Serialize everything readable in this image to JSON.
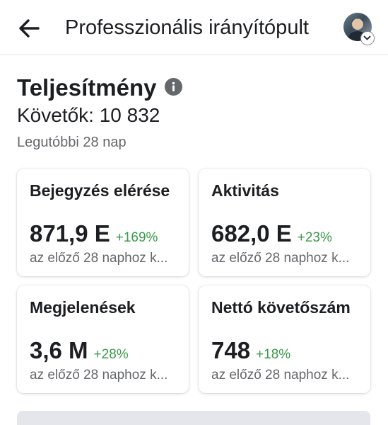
{
  "header": {
    "title": "Professzionális irányítópult",
    "back_icon": "arrow-left-icon",
    "avatar_icon": "profile-avatar",
    "account_switch_icon": "chevron-down-icon"
  },
  "performance": {
    "title": "Teljesítmény",
    "info_icon": "info-icon",
    "followers": "Követők: 10 832",
    "period": "Legutóbbi 28 nap"
  },
  "cards": [
    {
      "title": "Bejegyzés elérése",
      "value": "871,9 E",
      "change": "+169%",
      "note": "az előző 28 naphoz k..."
    },
    {
      "title": "Aktivitás",
      "value": "682,0 E",
      "change": "+23%",
      "note": "az előző 28 naphoz k..."
    },
    {
      "title": "Megjelenések",
      "value": "3,6 M",
      "change": "+28%",
      "note": "az előző 28 naphoz k..."
    },
    {
      "title": "Nettó követőszám",
      "value": "748",
      "change": "+18%",
      "note": "az előző 28 naphoz k..."
    }
  ],
  "colors": {
    "positive_change": "#3a9a4a",
    "secondary_text": "#65676b",
    "button_bg": "#e4e6eb"
  }
}
